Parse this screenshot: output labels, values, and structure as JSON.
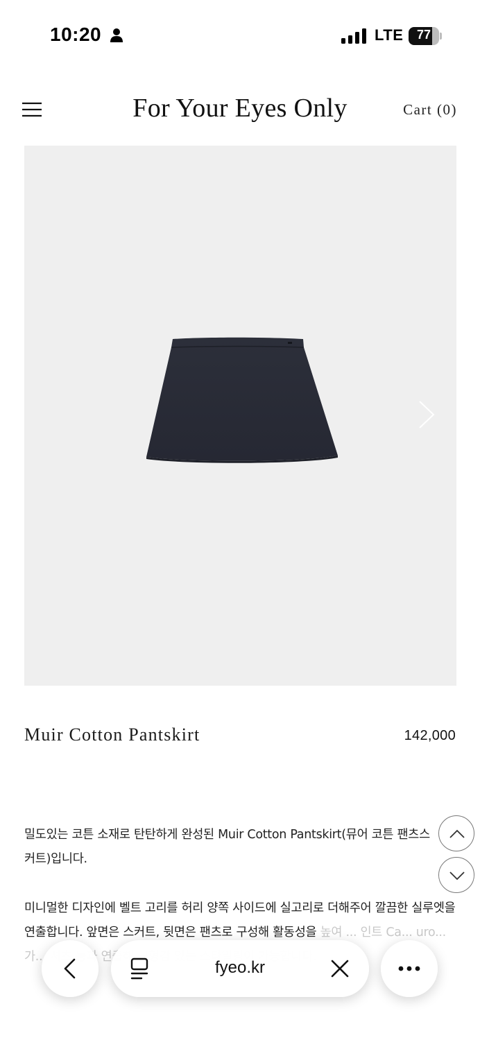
{
  "status_bar": {
    "time": "10:20",
    "network": "LTE",
    "battery_level": "77",
    "battery_fraction": 0.77
  },
  "header": {
    "brand": "For Your Eyes Only",
    "cart_label": "Cart (0)"
  },
  "product": {
    "image_alt": "dark navy mini skirt",
    "name": "Muir Cotton Pantskirt",
    "price": "142,000"
  },
  "description": {
    "paragraph_1": "밀도있는 코튼 소재로 탄탄하게 완성된 Muir Cotton Pantskirt(뮤어 코튼 팬츠스커트)입니다.",
    "paragraph_2_visible": "미니멀한 디자인에 벨트 고리를 허리 양쪽 사이드에 실고리로 더해주어 깔끔한 실루엣을 연출합니다. 앞면은 스커트, 뒷면은 팬츠로 구성해 활동성을",
    "paragraph_2_faded": "높여 ... 인트 Ca... uro... 가... 셔츠 등과 연출해 균형감 있는 스타일링이 가능합니다."
  },
  "browser": {
    "url": "fyeo.kr"
  },
  "icons": {
    "menu": "hamburger-menu-icon",
    "next": "chevron-right-icon",
    "scroll_up": "chevron-up-icon",
    "scroll_down": "chevron-down-icon",
    "back": "chevron-left-icon",
    "tabs": "tabs-icon",
    "close": "close-icon",
    "more": "more-icon"
  }
}
